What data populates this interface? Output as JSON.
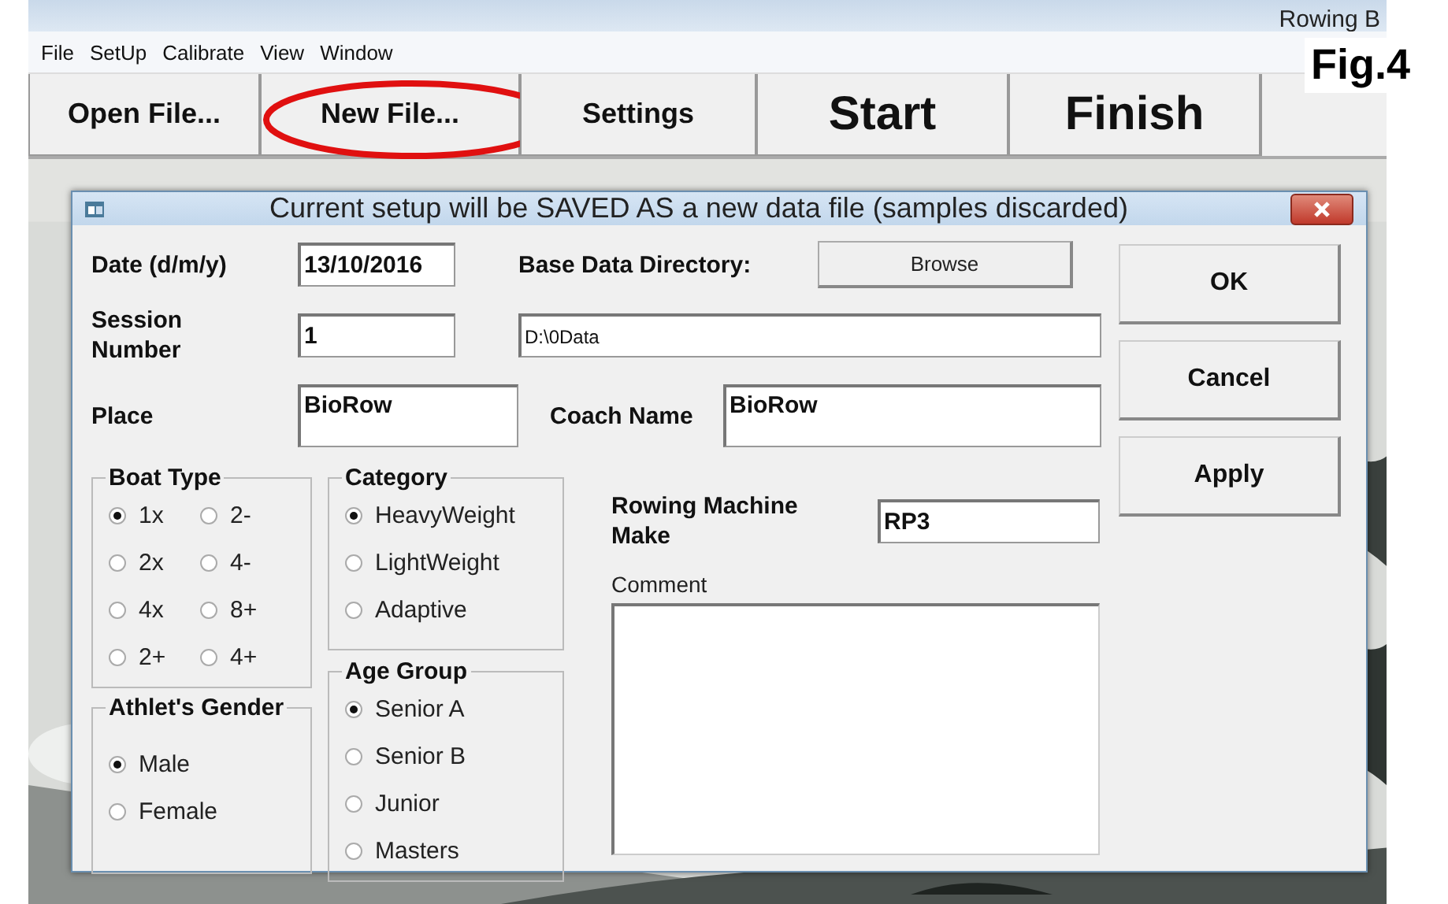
{
  "app_title": "Rowing B",
  "menu": [
    "File",
    "SetUp",
    "Calibrate",
    "View",
    "Window"
  ],
  "toolbar": [
    {
      "label": "Open File...",
      "kind": "normal",
      "highlighted": false
    },
    {
      "label": "New File...",
      "kind": "normal",
      "highlighted": true
    },
    {
      "label": "Settings",
      "kind": "normal",
      "highlighted": false
    },
    {
      "label": "Start",
      "kind": "large",
      "highlighted": false
    },
    {
      "label": "Finish",
      "kind": "large",
      "highlighted": false
    }
  ],
  "figure_label": "Fig.4",
  "dialog": {
    "title": "Current setup will be SAVED AS a new data file (samples discarded)",
    "date": {
      "label": "Date (d/m/y)",
      "value": "13/10/2016"
    },
    "session": {
      "label": "Session Number",
      "value": "1"
    },
    "base_dir": {
      "label": "Base Data Directory:",
      "browse": "Browse",
      "value": "D:\\0Data"
    },
    "place": {
      "label": "Place",
      "value": "BioRow"
    },
    "coach": {
      "label": "Coach Name",
      "value": "BioRow"
    },
    "boat_type": {
      "title": "Boat Type",
      "options": [
        {
          "label": "1x",
          "selected": true
        },
        {
          "label": "2-",
          "selected": false
        },
        {
          "label": "2x",
          "selected": false
        },
        {
          "label": "4-",
          "selected": false
        },
        {
          "label": "4x",
          "selected": false
        },
        {
          "label": "8+",
          "selected": false
        },
        {
          "label": "2+",
          "selected": false
        },
        {
          "label": "4+",
          "selected": false
        }
      ]
    },
    "gender": {
      "title": "Athlet's Gender",
      "options": [
        {
          "label": "Male",
          "selected": true
        },
        {
          "label": "Female",
          "selected": false
        }
      ]
    },
    "category": {
      "title": "Category",
      "options": [
        {
          "label": "HeavyWeight",
          "selected": true
        },
        {
          "label": "LightWeight",
          "selected": false
        },
        {
          "label": "Adaptive",
          "selected": false
        }
      ]
    },
    "age_group": {
      "title": "Age Group",
      "options": [
        {
          "label": "Senior A",
          "selected": true
        },
        {
          "label": "Senior B",
          "selected": false
        },
        {
          "label": "Junior",
          "selected": false
        },
        {
          "label": "Masters",
          "selected": false
        }
      ]
    },
    "machine": {
      "label": "Rowing Machine Make",
      "value": "RP3"
    },
    "comment": {
      "label": "Comment"
    },
    "buttons": [
      "OK",
      "Cancel",
      "Apply"
    ]
  }
}
